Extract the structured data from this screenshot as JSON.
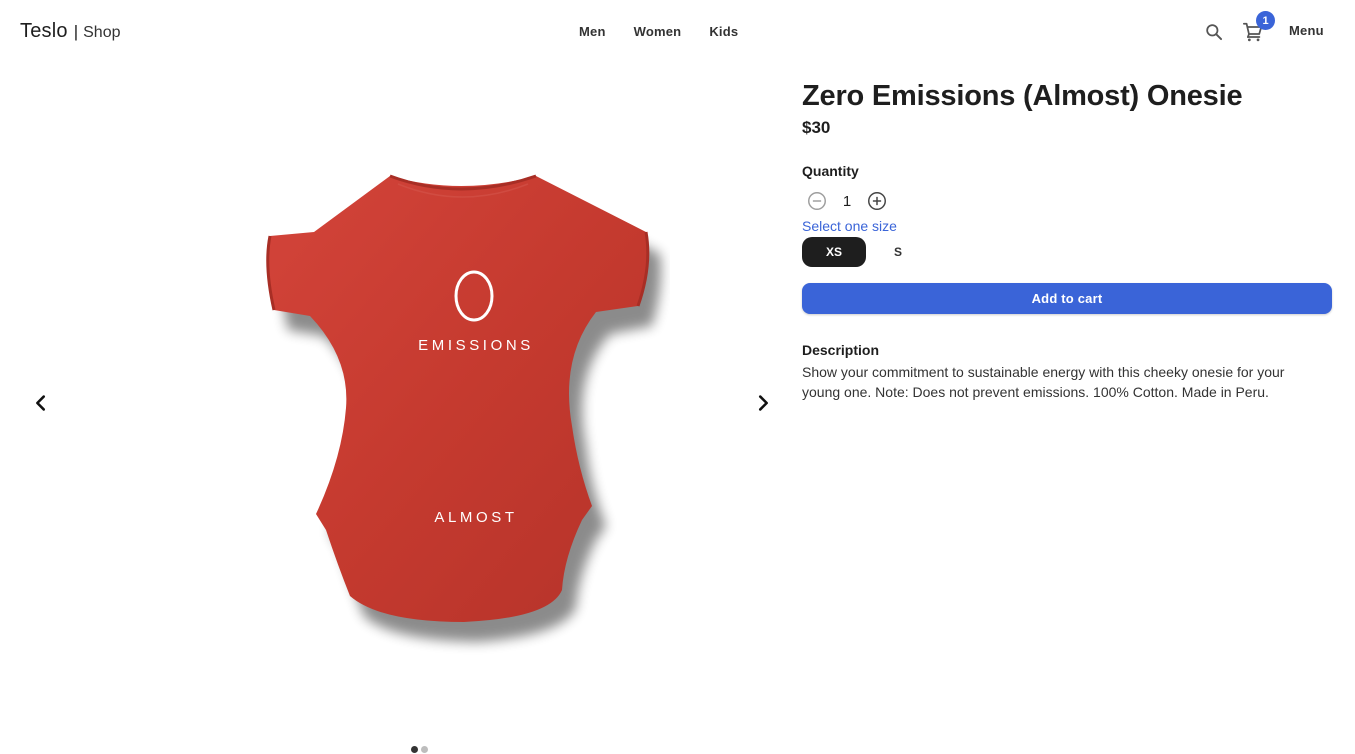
{
  "navbar": {
    "brand": "Teslo",
    "brand_separator": "|",
    "brand_sub": "Shop",
    "links": [
      {
        "label": "Men"
      },
      {
        "label": "Women"
      },
      {
        "label": "Kids"
      }
    ],
    "search_icon": "search-icon",
    "cart_icon": "shopping-cart-icon",
    "cart_count": "1",
    "menu_label": "Menu"
  },
  "gallery": {
    "prev_icon": "chevron-left-icon",
    "next_icon": "chevron-right-icon",
    "image": {
      "subject": "red onesie",
      "print_top": "EMISSIONS",
      "print_bottom": "ALMOST",
      "color": "#c53a2f"
    },
    "slides_count": 2,
    "active_slide": 1
  },
  "product": {
    "title": "Zero Emissions (Almost) Onesie",
    "price": "$30",
    "quantity_label": "Quantity",
    "quantity": "1",
    "size_label": "Select one size",
    "sizes": [
      {
        "label": "XS",
        "selected": true
      },
      {
        "label": "S",
        "selected": false
      }
    ],
    "add_to_cart": "Add to cart",
    "description_title": "Description",
    "description": "Show your commitment to sustainable energy with this cheeky onesie for your young one. Note: Does not prevent emissions. 100% Cotton. Made in Peru."
  },
  "colors": {
    "accent": "#3a64d8",
    "selected_chip": "#1e1e1e",
    "text": "#1e1e1e"
  }
}
